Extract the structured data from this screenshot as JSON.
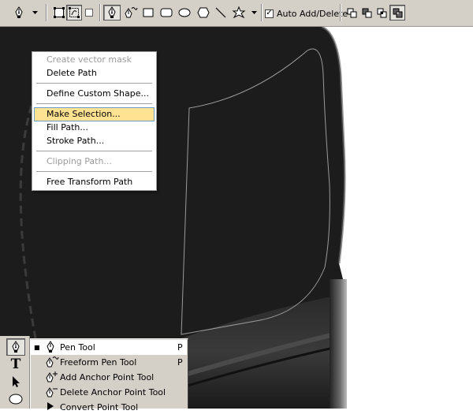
{
  "options_bar": {
    "auto_add_delete_label": "Auto Add/Delete",
    "auto_add_delete_checked": true,
    "check_glyph": "✓",
    "icons": [
      "pen-tool-preset-icon",
      "dropdown-arrow-icon",
      "shape-layers-icon",
      "paths-icon",
      "fill-pixels-icon",
      "pen-icon",
      "freeform-pen-icon",
      "rectangle-icon",
      "rounded-rectangle-icon",
      "ellipse-icon",
      "polygon-icon",
      "line-icon",
      "custom-shape-icon",
      "custom-shape-dropdown-icon",
      "add-to-path-area-icon",
      "subtract-from-path-area-icon",
      "intersect-path-areas-icon",
      "exclude-overlapping-path-areas-icon"
    ]
  },
  "context_menu": {
    "items": [
      {
        "label": "Create vector mask",
        "disabled": true
      },
      {
        "label": "Delete Path",
        "disabled": false
      },
      {
        "label": "Define Custom Shape...",
        "disabled": false
      },
      {
        "label": "Make Selection...",
        "disabled": false,
        "highlighted": true
      },
      {
        "label": "Fill Path...",
        "disabled": false
      },
      {
        "label": "Stroke Path...",
        "disabled": false
      },
      {
        "label": "Clipping Path...",
        "disabled": true
      },
      {
        "label": "Free Transform Path",
        "disabled": false
      }
    ]
  },
  "tools_panel": {
    "text_tool_glyph": "T"
  },
  "tool_flyout": {
    "items": [
      {
        "label": "Pen Tool",
        "shortcut": "P",
        "selected": true
      },
      {
        "label": "Freeform Pen Tool",
        "shortcut": "P",
        "selected": false
      },
      {
        "label": "Add Anchor Point Tool",
        "shortcut": "",
        "selected": false
      },
      {
        "label": "Delete Anchor Point Tool",
        "shortcut": "",
        "selected": false
      },
      {
        "label": "Convert Point Tool",
        "shortcut": "",
        "selected": false
      }
    ]
  },
  "colors": {
    "ui_gray": "#d4d0c8",
    "canvas_dark": "#1c1c1c",
    "menu_highlight": "#ffe393",
    "menu_highlight_border": "#6f9bc7",
    "path_stroke": "#9a9a9a"
  }
}
